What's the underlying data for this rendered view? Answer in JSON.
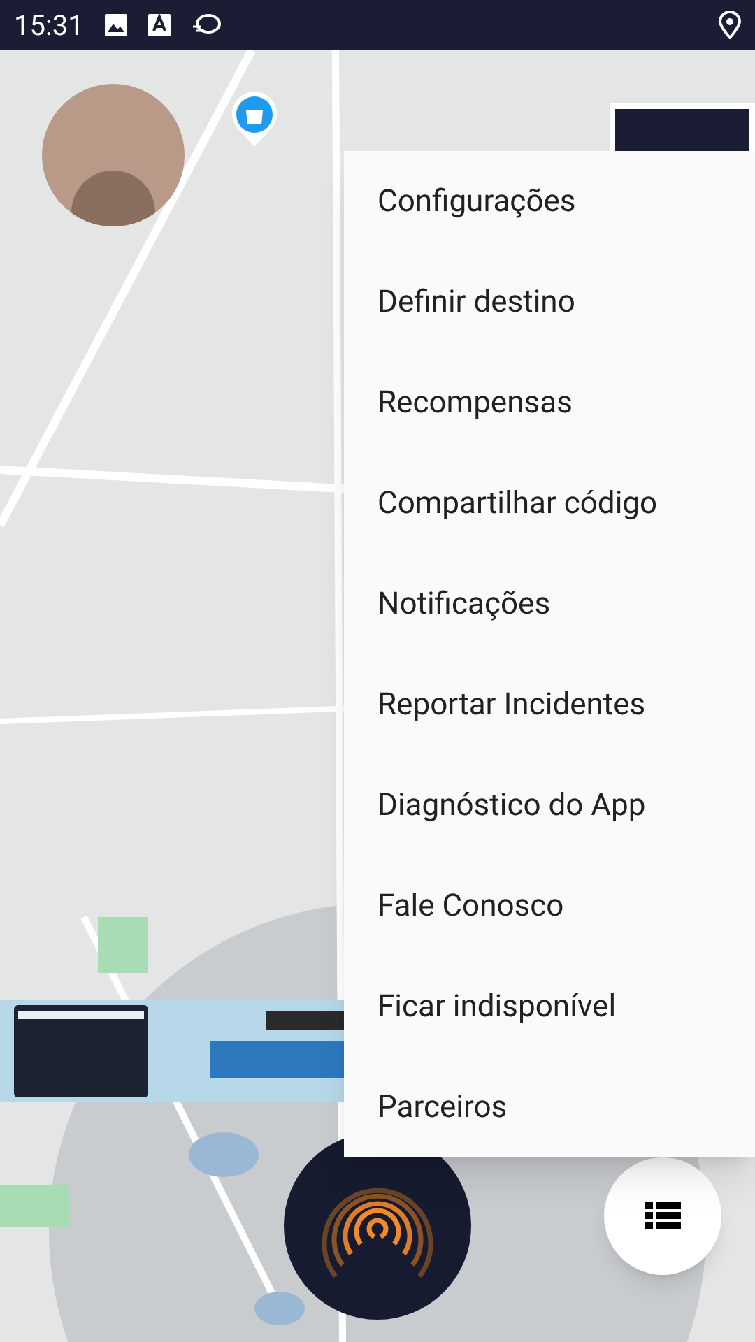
{
  "status_bar": {
    "time": "15:31"
  },
  "menu": {
    "items": [
      {
        "label": "Configurações"
      },
      {
        "label": "Definir destino"
      },
      {
        "label": "Recompensas"
      },
      {
        "label": "Compartilhar código"
      },
      {
        "label": "Notificações"
      },
      {
        "label": "Reportar Incidentes"
      },
      {
        "label": "Diagnóstico do App"
      },
      {
        "label": "Fale Conosco"
      },
      {
        "label": "Ficar indisponível"
      },
      {
        "label": "Parceiros"
      }
    ]
  }
}
